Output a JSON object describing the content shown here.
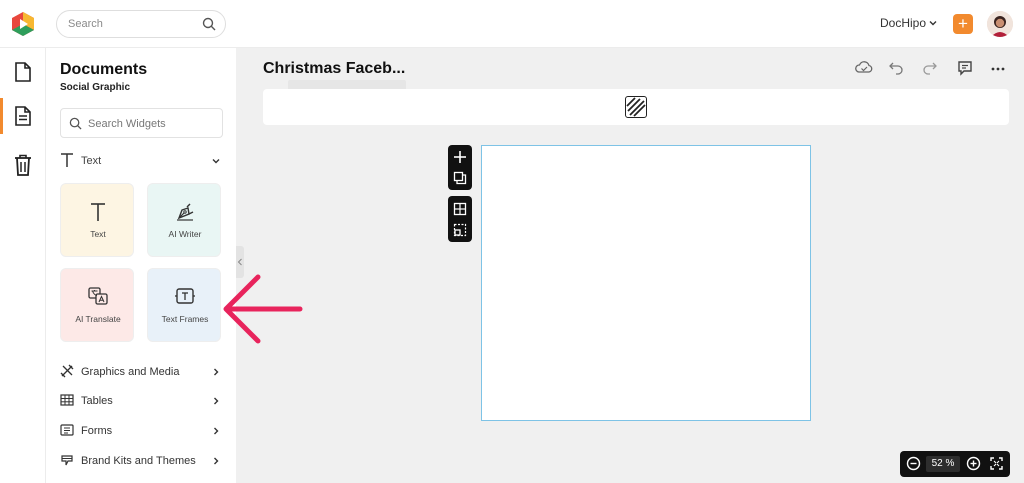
{
  "topbar": {
    "search_placeholder": "Search",
    "account_name": "DocHipo",
    "create_button": "+"
  },
  "rail": {
    "items": [
      {
        "icon": "document-icon"
      },
      {
        "icon": "document-text-icon",
        "active": true
      },
      {
        "icon": "trash-icon"
      }
    ]
  },
  "panel": {
    "title": "Documents",
    "subtitle": "Social Graphic",
    "search_placeholder": "Search Widgets",
    "section_label": "Text",
    "tiles": [
      {
        "label": "Text",
        "icon": "text-icon",
        "bg": "#fdf5e3"
      },
      {
        "label": "AI Writer",
        "icon": "pen-nib-icon",
        "bg": "#e9f6f4"
      },
      {
        "label": "AI Translate",
        "icon": "translate-icon",
        "bg": "#fde9e7"
      },
      {
        "label": "Text Frames",
        "icon": "text-frame-icon",
        "bg": "#e8f1f9"
      }
    ],
    "categories": [
      {
        "label": "Graphics and Media",
        "icon": "graphics-icon"
      },
      {
        "label": "Tables",
        "icon": "table-icon"
      },
      {
        "label": "Forms",
        "icon": "form-icon"
      },
      {
        "label": "Brand Kits and Themes",
        "icon": "brand-kit-icon"
      }
    ]
  },
  "editor": {
    "doc_title": "Christmas Faceb...",
    "zoom_value": "52",
    "zoom_unit": "%"
  },
  "colors": {
    "accent": "#f28a2e",
    "page_border": "#7ec3e6",
    "annotation_arrow": "#e8245c"
  }
}
